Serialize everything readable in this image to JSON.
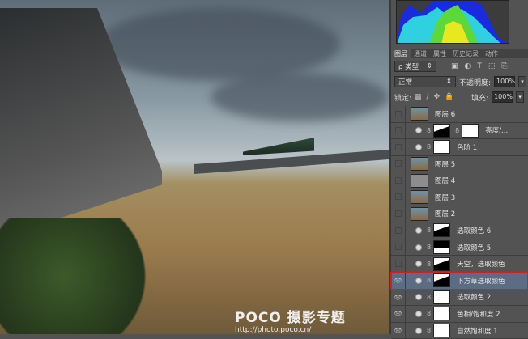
{
  "watermark": {
    "logo": "POCO 摄影专题",
    "url": "http://photo.poco.cn/"
  },
  "panel": {
    "tabs": [
      "图层",
      "通道",
      "属性",
      "历史记录",
      "动作"
    ],
    "filter_kind": "ρ 类型",
    "blend_mode": "正常",
    "opacity_label": "不透明度:",
    "opacity": "100%",
    "lock_label": "锁定:",
    "fill_label": "填充:",
    "fill": "100%",
    "layers": [
      {
        "name": "图层 6",
        "type": "pixel",
        "visible": false
      },
      {
        "name": "亮度/...",
        "type": "adjust2",
        "visible": false
      },
      {
        "name": "色阶 1",
        "type": "adjust",
        "visible": false
      },
      {
        "name": "图层 5",
        "type": "pixel",
        "visible": false
      },
      {
        "name": "图层 4",
        "type": "gray",
        "visible": false
      },
      {
        "name": "图层 3",
        "type": "pixel",
        "visible": false
      },
      {
        "name": "图层 2",
        "type": "pixel",
        "visible": false
      },
      {
        "name": "选取颜色 6",
        "type": "adjust-mask",
        "visible": false
      },
      {
        "name": "选取颜色 5",
        "type": "adjust-dark",
        "visible": false
      },
      {
        "name": "天空，选取颜色",
        "type": "adjust-mask",
        "visible": false
      },
      {
        "name": "下方草选取颜色",
        "type": "adjust-mask",
        "visible": true,
        "selected": true
      },
      {
        "name": "选取颜色 2",
        "type": "adjust",
        "visible": true
      },
      {
        "name": "色相/饱和度 2",
        "type": "adjust",
        "visible": true
      },
      {
        "name": "自然饱和度 1",
        "type": "adjust",
        "visible": true
      }
    ]
  }
}
